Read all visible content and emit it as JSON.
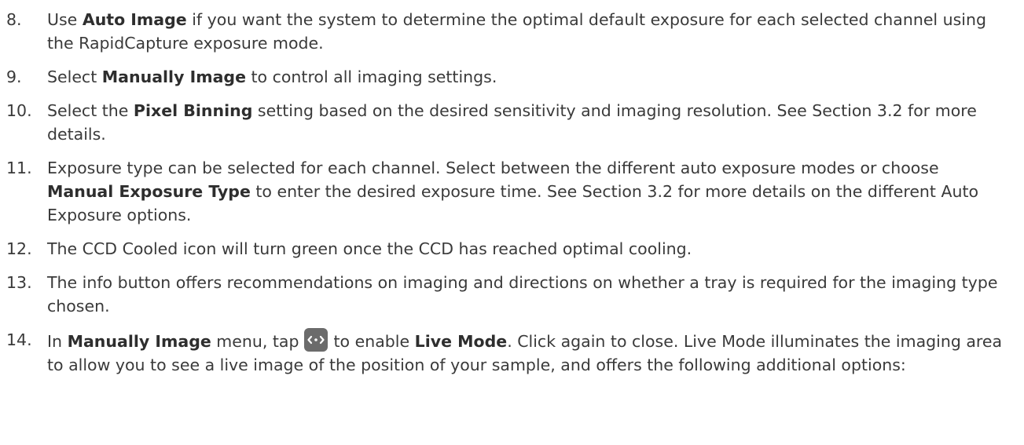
{
  "steps": [
    {
      "num": "8.",
      "parts": [
        {
          "t": "Use "
        },
        {
          "t": "Auto Image",
          "b": true
        },
        {
          "t": " if you want the system to determine the optimal default exposure for each selected channel using the RapidCapture exposure mode."
        }
      ]
    },
    {
      "num": "9.",
      "parts": [
        {
          "t": "Select "
        },
        {
          "t": "Manually Image",
          "b": true
        },
        {
          "t": " to control all imaging settings."
        }
      ]
    },
    {
      "num": "10.",
      "parts": [
        {
          "t": "Select the "
        },
        {
          "t": "Pixel Binning",
          "b": true
        },
        {
          "t": " setting based on the desired sensitivity and imaging resolution. See Section 3.2 for more details."
        }
      ]
    },
    {
      "num": "11.",
      "parts": [
        {
          "t": "Exposure type can be selected for each channel. Select between the different auto exposure modes or choose "
        },
        {
          "t": "Manual Exposure Type",
          "b": true
        },
        {
          "t": " to enter the desired exposure time. See Section 3.2 for more details on the different Auto Exposure options."
        }
      ]
    },
    {
      "num": "12.",
      "parts": [
        {
          "t": "The CCD Cooled icon will turn green once the CCD has reached optimal cooling."
        }
      ]
    },
    {
      "num": "13.",
      "parts": [
        {
          "t": "The info button offers recommendations on imaging and directions on whether a tray is required for the imaging type chosen."
        }
      ]
    },
    {
      "num": "14.",
      "parts": [
        {
          "t": "In "
        },
        {
          "t": "Manually Image",
          "b": true
        },
        {
          "t": " menu, tap"
        },
        {
          "icon": "live-mode-icon"
        },
        {
          "t": "to enable "
        },
        {
          "t": "Live Mode",
          "b": true
        },
        {
          "t": ". Click again to close. Live Mode illuminates the imaging area to allow you to see a live image of the position of your sample, and offers the following additional options:"
        }
      ]
    }
  ]
}
